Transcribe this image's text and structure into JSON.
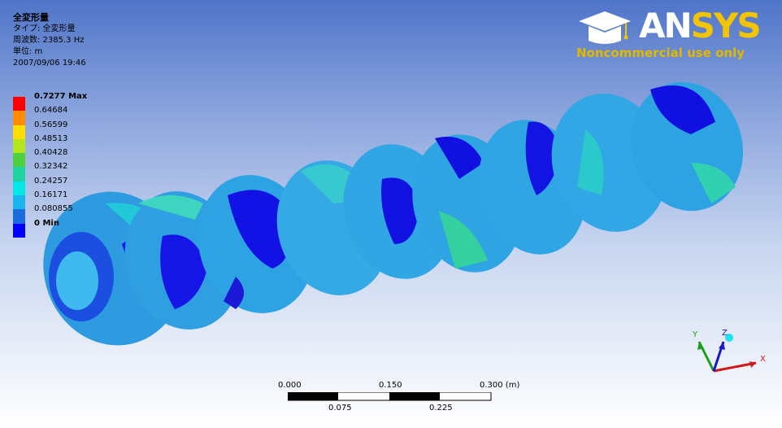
{
  "info": {
    "title": "全変形量",
    "type": "タイプ: 全変形量",
    "frequency": "周波数: 2385.3 Hz",
    "unit": "単位: m",
    "datetime": "2007/09/06 19:46"
  },
  "legend": {
    "items": [
      {
        "label": "0.7277 Max",
        "color": "#ff0000",
        "bold": true
      },
      {
        "label": "0.64684",
        "color": "#ff8c00",
        "bold": false
      },
      {
        "label": "0.56599",
        "color": "#ffdd00",
        "bold": false
      },
      {
        "label": "0.48513",
        "color": "#b5e61d",
        "bold": false
      },
      {
        "label": "0.40428",
        "color": "#4fd040",
        "bold": false
      },
      {
        "label": "0.32342",
        "color": "#1fd4a0",
        "bold": false
      },
      {
        "label": "0.24257",
        "color": "#00e6e6",
        "bold": false
      },
      {
        "label": "0.16171",
        "color": "#1cb6ee",
        "bold": false
      },
      {
        "label": "0.080855",
        "color": "#1a6ae0",
        "bold": false
      },
      {
        "label": "0 Min",
        "color": "#0000ff",
        "bold": true
      }
    ]
  },
  "logo": {
    "brand_a": "AN",
    "brand_b": "SYS",
    "note": "Noncommercial use only"
  },
  "scale": {
    "top_labels": [
      "0.000",
      "0.150",
      "0.300 (m)"
    ],
    "bottom_labels": [
      "0.075",
      "0.225"
    ]
  },
  "triad": {
    "x": "X",
    "y": "Y",
    "z": "Z"
  }
}
